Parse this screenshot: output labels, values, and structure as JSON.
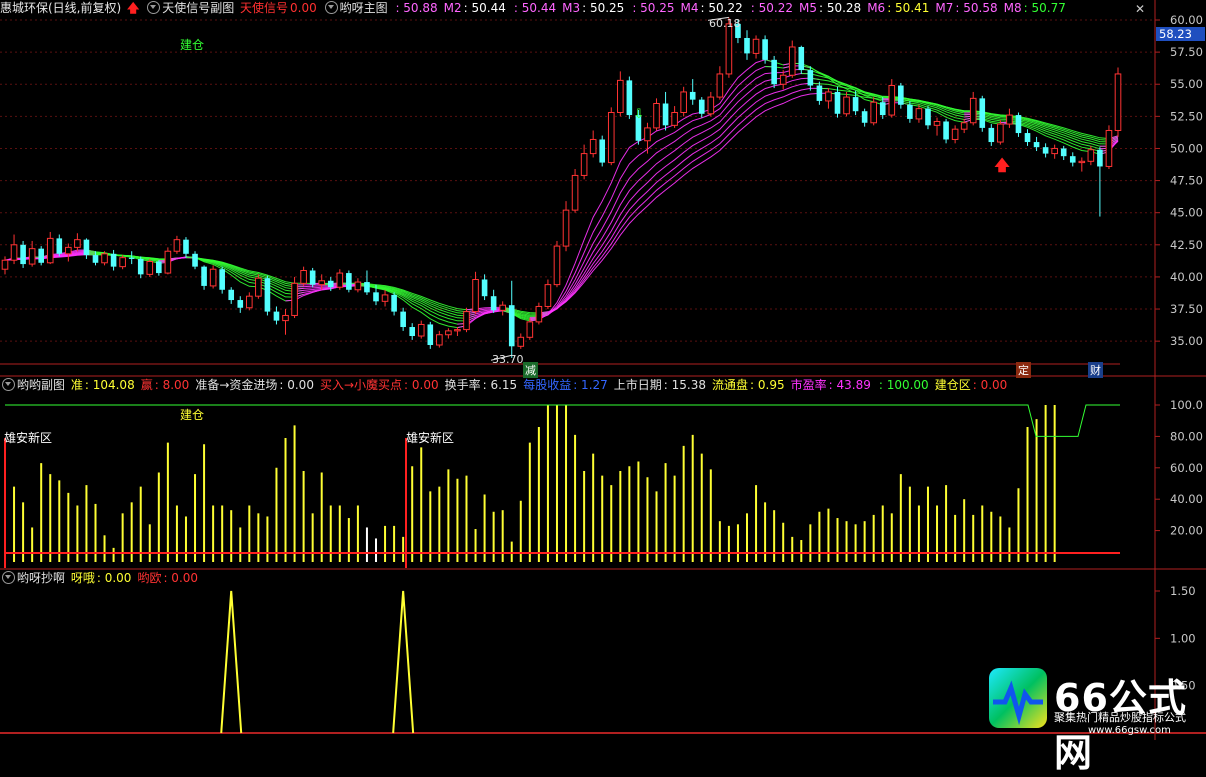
{
  "main_header": {
    "stock": "惠城环保(日线,前复权)",
    "ind1_name": "天使信号副图",
    "ind1_label": "天使信号",
    "ind1_value": "0.00",
    "ind2_name": "哟呀主图",
    "ma_values": [
      {
        "label": "",
        "value": ": 50.88"
      },
      {
        "label": "M2",
        "value": ": 50.44"
      },
      {
        "label": "",
        "value": ": 50.44"
      },
      {
        "label": "M3",
        "value": ": 50.25"
      },
      {
        "label": "",
        "value": ": 50.25"
      },
      {
        "label": "M4",
        "value": ": 50.22"
      },
      {
        "label": "",
        "value": ": 50.22"
      },
      {
        "label": "M5",
        "value": ": 50.28"
      },
      {
        "label": "M6",
        "value": ": 50.41"
      },
      {
        "label": "M7",
        "value": ": 50.58"
      },
      {
        "label": "M8",
        "value": ": 50.77"
      }
    ]
  },
  "sub1_header": {
    "name": "哟哟副图",
    "items": [
      {
        "label": "准",
        "value": ": 104.08"
      },
      {
        "label": "赢",
        "value": ": 8.00"
      },
      {
        "label": "准备→资金进场",
        "value": ": 0.00"
      },
      {
        "label": "买入→小魔买点",
        "value": ": 0.00"
      },
      {
        "label": "换手率",
        "value": ": 6.15"
      },
      {
        "label": "每股收益",
        "value": ": 1.27"
      },
      {
        "label": "上市日期",
        "value": ": 15.38"
      },
      {
        "label": "流通盘",
        "value": ": 0.95"
      },
      {
        "label": "市盈率",
        "value": ": 43.89"
      },
      {
        "label": "",
        "value": ": 100.00"
      },
      {
        "label": "建仓区",
        "value": ": 0.00"
      }
    ]
  },
  "sub2_header": {
    "name": "哟呀抄啊",
    "items": [
      {
        "label": "呀哦",
        "value": ": 0.00"
      },
      {
        "label": "哟欧",
        "value": ": 0.00"
      }
    ]
  },
  "annotations": {
    "jiancang_main": "建仓",
    "jiancang_sub": "建仓",
    "xiongan_1": "雄安新区",
    "xiongan_2": "雄安新区",
    "high_label": "60.18",
    "low_label": "33.70",
    "jian": "减",
    "ding": "定",
    "cai": "财",
    "current_price": "58.23"
  },
  "colors": {
    "up": "#ff3333",
    "down": "#54ffff",
    "ribbon_green": "#33ff33",
    "ribbon_magenta": "#ff33ff",
    "bar_yellow": "#ffff33",
    "bar_white": "#ffffff"
  },
  "logo": {
    "brand": "66公式网",
    "sub": "聚集热门精品炒股指标公式",
    "url": "www.66gsw.com"
  },
  "chart_data": [
    {
      "type": "candlestick",
      "title": "惠城环保(日线,前复权)",
      "yticks": [
        "60.00",
        "57.50",
        "55.00",
        "52.50",
        "50.00",
        "47.50",
        "45.00",
        "42.50",
        "40.00",
        "37.50",
        "35.00"
      ],
      "ylim": [
        33.0,
        61.0
      ],
      "candles": [
        [
          40.6,
          41.6,
          40.2,
          41.3
        ],
        [
          41.3,
          43.3,
          41.0,
          42.5
        ],
        [
          42.5,
          42.8,
          40.7,
          41.0
        ],
        [
          41.0,
          42.8,
          40.8,
          42.2
        ],
        [
          42.2,
          42.4,
          40.9,
          41.1
        ],
        [
          41.1,
          43.5,
          41.0,
          43.0
        ],
        [
          43.0,
          43.3,
          41.6,
          41.8
        ],
        [
          41.8,
          42.6,
          41.2,
          42.3
        ],
        [
          42.3,
          43.4,
          42.0,
          42.9
        ],
        [
          42.9,
          43.0,
          41.4,
          41.7
        ],
        [
          41.7,
          42.0,
          40.9,
          41.1
        ],
        [
          41.1,
          42.0,
          40.9,
          41.8
        ],
        [
          41.8,
          42.1,
          40.5,
          40.8
        ],
        [
          40.8,
          41.7,
          40.6,
          41.5
        ],
        [
          41.5,
          42.0,
          41.0,
          41.4
        ],
        [
          41.4,
          41.6,
          39.9,
          40.2
        ],
        [
          40.2,
          41.4,
          40.0,
          41.2
        ],
        [
          41.2,
          41.3,
          40.1,
          40.3
        ],
        [
          40.3,
          42.3,
          40.2,
          42.0
        ],
        [
          42.0,
          43.2,
          41.8,
          42.9
        ],
        [
          42.9,
          43.1,
          41.5,
          41.8
        ],
        [
          41.8,
          42.0,
          40.6,
          40.8
        ],
        [
          40.8,
          40.9,
          39.0,
          39.3
        ],
        [
          39.3,
          40.9,
          39.1,
          40.6
        ],
        [
          40.6,
          40.8,
          38.7,
          39.0
        ],
        [
          39.0,
          39.2,
          37.9,
          38.2
        ],
        [
          38.2,
          38.5,
          37.2,
          37.6
        ],
        [
          37.6,
          38.8,
          37.4,
          38.5
        ],
        [
          38.5,
          40.2,
          38.3,
          39.9
        ],
        [
          39.9,
          40.1,
          37.0,
          37.3
        ],
        [
          37.3,
          37.7,
          36.3,
          36.6
        ],
        [
          36.6,
          37.5,
          35.5,
          37.0
        ],
        [
          37.0,
          40.0,
          36.8,
          39.5
        ],
        [
          39.5,
          40.8,
          39.3,
          40.5
        ],
        [
          40.5,
          40.7,
          39.2,
          39.4
        ],
        [
          39.4,
          40.2,
          39.0,
          39.7
        ],
        [
          39.7,
          40.0,
          38.9,
          39.2
        ],
        [
          39.2,
          40.6,
          39.0,
          40.3
        ],
        [
          40.3,
          40.5,
          38.8,
          39.0
        ],
        [
          39.0,
          39.9,
          38.8,
          39.6
        ],
        [
          39.6,
          40.5,
          38.6,
          38.8
        ],
        [
          38.8,
          39.4,
          37.8,
          38.1
        ],
        [
          38.1,
          39.0,
          37.7,
          38.6
        ],
        [
          38.6,
          38.8,
          37.0,
          37.3
        ],
        [
          37.3,
          37.6,
          35.8,
          36.1
        ],
        [
          36.1,
          36.4,
          35.1,
          35.4
        ],
        [
          35.4,
          36.6,
          35.2,
          36.3
        ],
        [
          36.3,
          36.5,
          34.4,
          34.7
        ],
        [
          34.7,
          35.8,
          34.5,
          35.5
        ],
        [
          35.5,
          36.0,
          35.2,
          35.8
        ],
        [
          35.8,
          36.1,
          35.4,
          35.9
        ],
        [
          35.9,
          37.6,
          35.7,
          37.3
        ],
        [
          37.3,
          40.4,
          37.1,
          39.8
        ],
        [
          39.8,
          40.2,
          38.2,
          38.5
        ],
        [
          38.5,
          39.0,
          37.2,
          37.4
        ],
        [
          37.4,
          38.1,
          37.0,
          37.8
        ],
        [
          37.8,
          39.7,
          33.7,
          34.6
        ],
        [
          34.6,
          35.6,
          34.4,
          35.3
        ],
        [
          35.3,
          36.8,
          35.1,
          36.5
        ],
        [
          36.5,
          38.0,
          36.3,
          37.7
        ],
        [
          37.7,
          39.8,
          37.5,
          39.4
        ],
        [
          39.4,
          42.8,
          39.2,
          42.4
        ],
        [
          42.4,
          45.9,
          42.0,
          45.2
        ],
        [
          45.2,
          48.4,
          45.0,
          47.9
        ],
        [
          47.9,
          50.3,
          47.6,
          49.6
        ],
        [
          49.6,
          51.4,
          49.3,
          50.7
        ],
        [
          50.7,
          51.0,
          48.6,
          48.9
        ],
        [
          48.9,
          53.2,
          48.7,
          52.8
        ],
        [
          52.8,
          56.0,
          52.5,
          55.3
        ],
        [
          55.3,
          55.6,
          52.3,
          52.6
        ],
        [
          52.6,
          53.0,
          50.3,
          50.6
        ],
        [
          50.6,
          52.0,
          49.6,
          51.6
        ],
        [
          51.6,
          53.9,
          51.4,
          53.5
        ],
        [
          53.5,
          54.4,
          51.4,
          51.8
        ],
        [
          51.8,
          53.3,
          51.6,
          52.8
        ],
        [
          52.8,
          54.8,
          52.5,
          54.4
        ],
        [
          54.4,
          55.4,
          53.4,
          53.8
        ],
        [
          53.8,
          54.0,
          52.4,
          52.7
        ],
        [
          52.7,
          54.4,
          52.5,
          54.0
        ],
        [
          54.0,
          56.4,
          53.8,
          55.8
        ],
        [
          55.8,
          60.2,
          55.5,
          59.7
        ],
        [
          59.7,
          60.0,
          58.2,
          58.6
        ],
        [
          58.6,
          59.2,
          56.9,
          57.4
        ],
        [
          57.4,
          58.8,
          57.0,
          58.5
        ],
        [
          58.5,
          58.8,
          56.6,
          56.9
        ],
        [
          56.9,
          57.2,
          54.7,
          55.0
        ],
        [
          55.0,
          56.1,
          54.6,
          55.7
        ],
        [
          55.7,
          58.4,
          55.5,
          57.9
        ],
        [
          57.9,
          58.0,
          55.8,
          56.1
        ],
        [
          56.1,
          56.4,
          54.5,
          54.9
        ],
        [
          54.9,
          55.2,
          53.4,
          53.7
        ],
        [
          53.7,
          54.7,
          53.1,
          54.4
        ],
        [
          54.4,
          54.8,
          52.4,
          52.7
        ],
        [
          52.7,
          54.4,
          52.5,
          54.0
        ],
        [
          54.0,
          54.5,
          52.6,
          52.9
        ],
        [
          52.9,
          53.1,
          51.7,
          52.0
        ],
        [
          52.0,
          54.0,
          51.8,
          53.6
        ],
        [
          53.6,
          54.0,
          52.3,
          52.6
        ],
        [
          52.6,
          55.4,
          52.4,
          54.9
        ],
        [
          54.9,
          55.1,
          53.1,
          53.4
        ],
        [
          53.4,
          53.7,
          52.0,
          52.3
        ],
        [
          52.3,
          53.4,
          52.0,
          53.1
        ],
        [
          53.1,
          53.3,
          51.5,
          51.8
        ],
        [
          51.8,
          52.4,
          51.0,
          52.1
        ],
        [
          52.1,
          52.3,
          50.4,
          50.7
        ],
        [
          50.7,
          51.8,
          50.4,
          51.5
        ],
        [
          51.5,
          52.3,
          51.2,
          52.0
        ],
        [
          52.0,
          54.4,
          51.8,
          53.9
        ],
        [
          53.9,
          54.1,
          51.3,
          51.6
        ],
        [
          51.6,
          51.9,
          50.2,
          50.5
        ],
        [
          50.5,
          52.2,
          50.3,
          51.9
        ],
        [
          51.9,
          53.1,
          51.6,
          52.6
        ],
        [
          52.6,
          52.8,
          50.9,
          51.2
        ],
        [
          51.2,
          51.5,
          50.2,
          50.5
        ],
        [
          50.5,
          50.9,
          49.8,
          50.1
        ],
        [
          50.1,
          50.4,
          49.3,
          49.6
        ],
        [
          49.6,
          50.3,
          49.2,
          50.0
        ],
        [
          50.0,
          50.2,
          49.1,
          49.4
        ],
        [
          49.4,
          49.7,
          48.6,
          48.9
        ],
        [
          48.9,
          49.3,
          48.2,
          49.0
        ],
        [
          49.0,
          50.2,
          48.7,
          49.9
        ],
        [
          49.9,
          50.1,
          44.7,
          48.6
        ],
        [
          48.6,
          51.8,
          48.4,
          51.4
        ],
        [
          51.4,
          56.3,
          50.9,
          55.8
        ]
      ]
    },
    {
      "type": "bar",
      "title": "哟哟副图",
      "yticks": [
        "100.0",
        "80.00",
        "60.00",
        "40.00",
        "20.00"
      ],
      "ylim": [
        0,
        110
      ],
      "values": [
        0,
        48,
        38,
        22,
        63,
        56,
        52,
        44,
        36,
        49,
        37,
        17,
        9,
        31,
        38,
        48,
        24,
        57,
        76,
        36,
        29,
        56,
        75,
        36,
        36,
        33,
        22,
        36,
        31,
        29,
        60,
        79,
        87,
        58,
        31,
        57,
        36,
        36,
        28,
        36,
        22,
        15,
        23,
        23,
        16,
        61,
        73,
        45,
        48,
        59,
        53,
        55,
        21,
        43,
        32,
        33,
        13,
        39,
        76,
        86,
        100,
        100,
        100,
        81,
        58,
        69,
        55,
        49,
        58,
        61,
        64,
        54,
        45,
        63,
        55,
        74,
        81,
        69,
        59,
        26,
        23,
        24,
        31,
        49,
        38,
        33,
        25,
        16,
        14,
        24,
        32,
        34,
        28,
        26,
        24,
        26,
        30,
        36,
        31,
        56,
        48,
        36,
        48,
        36,
        49,
        30,
        40,
        30,
        36,
        32,
        29,
        22,
        47,
        86,
        91,
        100,
        100
      ],
      "bar_color_override": {
        "40": "#ffffff",
        "41": "#ffffff"
      },
      "line_label": "100.00"
    },
    {
      "type": "line",
      "title": "哟呀抄啊",
      "yticks": [
        "1.50",
        "1.00",
        "0.50"
      ],
      "ylim": [
        0,
        1.7
      ],
      "spikes": [
        {
          "index": 25,
          "value": 1.5
        },
        {
          "index": 44,
          "value": 1.5
        }
      ]
    }
  ]
}
